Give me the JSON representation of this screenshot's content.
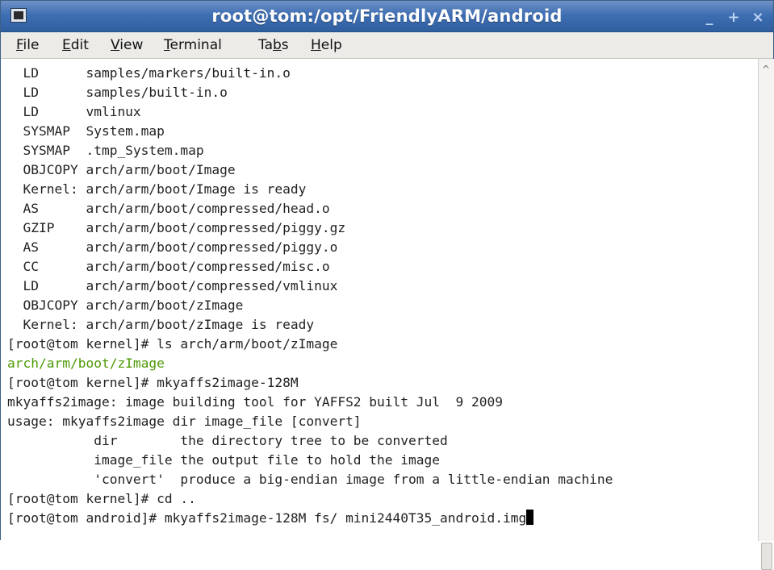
{
  "window": {
    "title": "root@tom:/opt/FriendlyARM/android",
    "controls": {
      "minimize": "_",
      "maximize": "+",
      "close": "×"
    }
  },
  "menubar": {
    "file": {
      "pre": "",
      "acc": "F",
      "post": "ile"
    },
    "edit": {
      "pre": "",
      "acc": "E",
      "post": "dit"
    },
    "view": {
      "pre": "",
      "acc": "V",
      "post": "iew"
    },
    "terminal": {
      "pre": "",
      "acc": "T",
      "post": "erminal"
    },
    "tabs": {
      "pre": "Ta",
      "acc": "b",
      "post": "s"
    },
    "help": {
      "pre": "",
      "acc": "H",
      "post": "elp"
    }
  },
  "terminal": {
    "lines": [
      "  LD      samples/markers/built-in.o",
      "  LD      samples/built-in.o",
      "  LD      vmlinux",
      "  SYSMAP  System.map",
      "  SYSMAP  .tmp_System.map",
      "  OBJCOPY arch/arm/boot/Image",
      "  Kernel: arch/arm/boot/Image is ready",
      "  AS      arch/arm/boot/compressed/head.o",
      "  GZIP    arch/arm/boot/compressed/piggy.gz",
      "  AS      arch/arm/boot/compressed/piggy.o",
      "  CC      arch/arm/boot/compressed/misc.o",
      "  LD      arch/arm/boot/compressed/vmlinux",
      "  OBJCOPY arch/arm/boot/zImage",
      "  Kernel: arch/arm/boot/zImage is ready",
      "[root@tom kernel]# ls arch/arm/boot/zImage",
      "arch/arm/boot/zImage",
      "[root@tom kernel]# mkyaffs2image-128M",
      "mkyaffs2image: image building tool for YAFFS2 built Jul  9 2009",
      "usage: mkyaffs2image dir image_file [convert]",
      "           dir        the directory tree to be converted",
      "           image_file the output file to hold the image",
      "           'convert'  produce a big-endian image from a little-endian machine",
      "[root@tom kernel]# cd ..",
      "[root@tom android]# mkyaffs2image-128M fs/ mini2440T35_android.img"
    ],
    "highlight_color": "#4e9a06"
  }
}
